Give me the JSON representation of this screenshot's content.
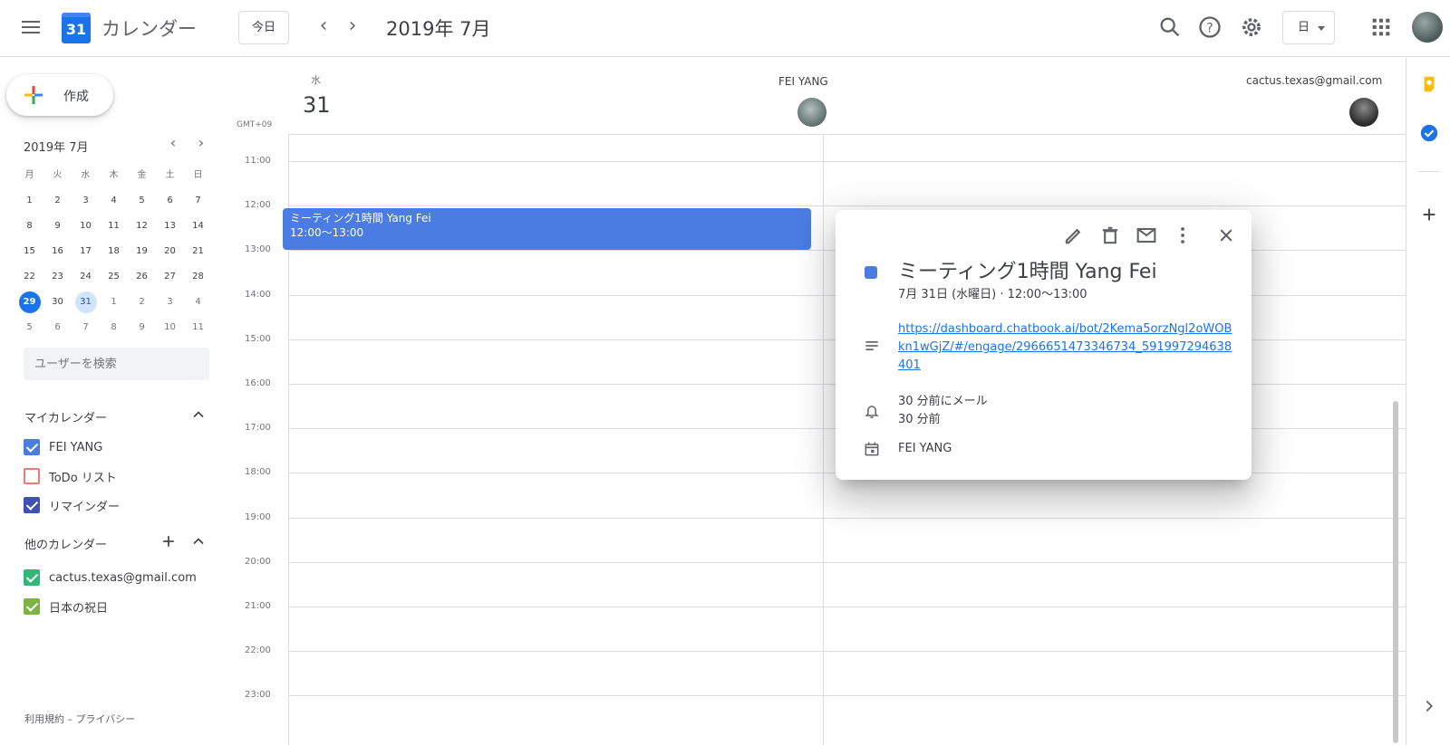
{
  "header": {
    "menu_icon": "hamburger-menu-icon",
    "logo_text": "31",
    "app_title": "カレンダー",
    "today_label": "今日",
    "date_title": "2019年 7月",
    "view_selected": "日",
    "icons": [
      "search-icon",
      "help-icon",
      "settings-icon",
      "apps-grid-icon"
    ]
  },
  "sidebar": {
    "create_label": "作成",
    "mini_cal": {
      "title": "2019年 7月",
      "dow": [
        "月",
        "火",
        "水",
        "木",
        "金",
        "土",
        "日"
      ],
      "weeks": [
        [
          "1",
          "2",
          "3",
          "4",
          "5",
          "6",
          "7"
        ],
        [
          "8",
          "9",
          "10",
          "11",
          "12",
          "13",
          "14"
        ],
        [
          "15",
          "16",
          "17",
          "18",
          "19",
          "20",
          "21"
        ],
        [
          "22",
          "23",
          "24",
          "25",
          "26",
          "27",
          "28"
        ],
        [
          "29",
          "30",
          "31",
          "1",
          "2",
          "3",
          "4"
        ],
        [
          "5",
          "6",
          "7",
          "8",
          "9",
          "10",
          "11"
        ]
      ],
      "today": "29",
      "selected": "31"
    },
    "user_search_placeholder": "ユーザーを検索",
    "my_calendars_title": "マイカレンダー",
    "my_calendars": [
      {
        "label": "FEI YANG",
        "color": "#4a7ce2",
        "checked": true
      },
      {
        "label": "ToDo リスト",
        "color": "#e67c73",
        "checked": false
      },
      {
        "label": "リマインダー",
        "color": "#3f51b5",
        "checked": true
      }
    ],
    "other_calendars_title": "他のカレンダー",
    "other_calendars": [
      {
        "label": "cactus.texas@gmail.com",
        "color": "#33b679",
        "checked": true
      },
      {
        "label": "日本の祝日",
        "color": "#7cb342",
        "checked": true
      }
    ],
    "footer": "利用規約 – プライバシー"
  },
  "main": {
    "dow": "水",
    "day_num": "31",
    "timezone": "GMT+09",
    "columns": [
      {
        "name": "FEI YANG"
      },
      {
        "name": "cactus.texas@gmail.com"
      }
    ],
    "hours": [
      "11:00",
      "12:00",
      "13:00",
      "14:00",
      "15:00",
      "16:00",
      "17:00",
      "18:00",
      "19:00",
      "20:00",
      "21:00",
      "22:00",
      "23:00"
    ],
    "event": {
      "title": "ミーティング1時間 Yang Fei",
      "time": "12:00〜13:00",
      "color": "#4a7ce2"
    }
  },
  "popup": {
    "title": "ミーティング1時間 Yang Fei",
    "subtitle": "7月 31日 (水曜日)  ·  12:00〜13:00",
    "link": "https://dashboard.chatbook.ai/bot/2Kema5orzNgl2oWOBkn1wGjZ/#/engage/2966651473346734_591997294638401",
    "reminder1": "30 分前にメール",
    "reminder2": "30 分前",
    "calendar": "FEI YANG",
    "actions": [
      "edit-icon",
      "delete-icon",
      "email-icon",
      "more-options-icon",
      "close-icon"
    ]
  },
  "rail": {
    "icons": [
      "keep-icon",
      "tasks-icon",
      "add-addon-icon",
      "expand-panel-icon"
    ]
  }
}
